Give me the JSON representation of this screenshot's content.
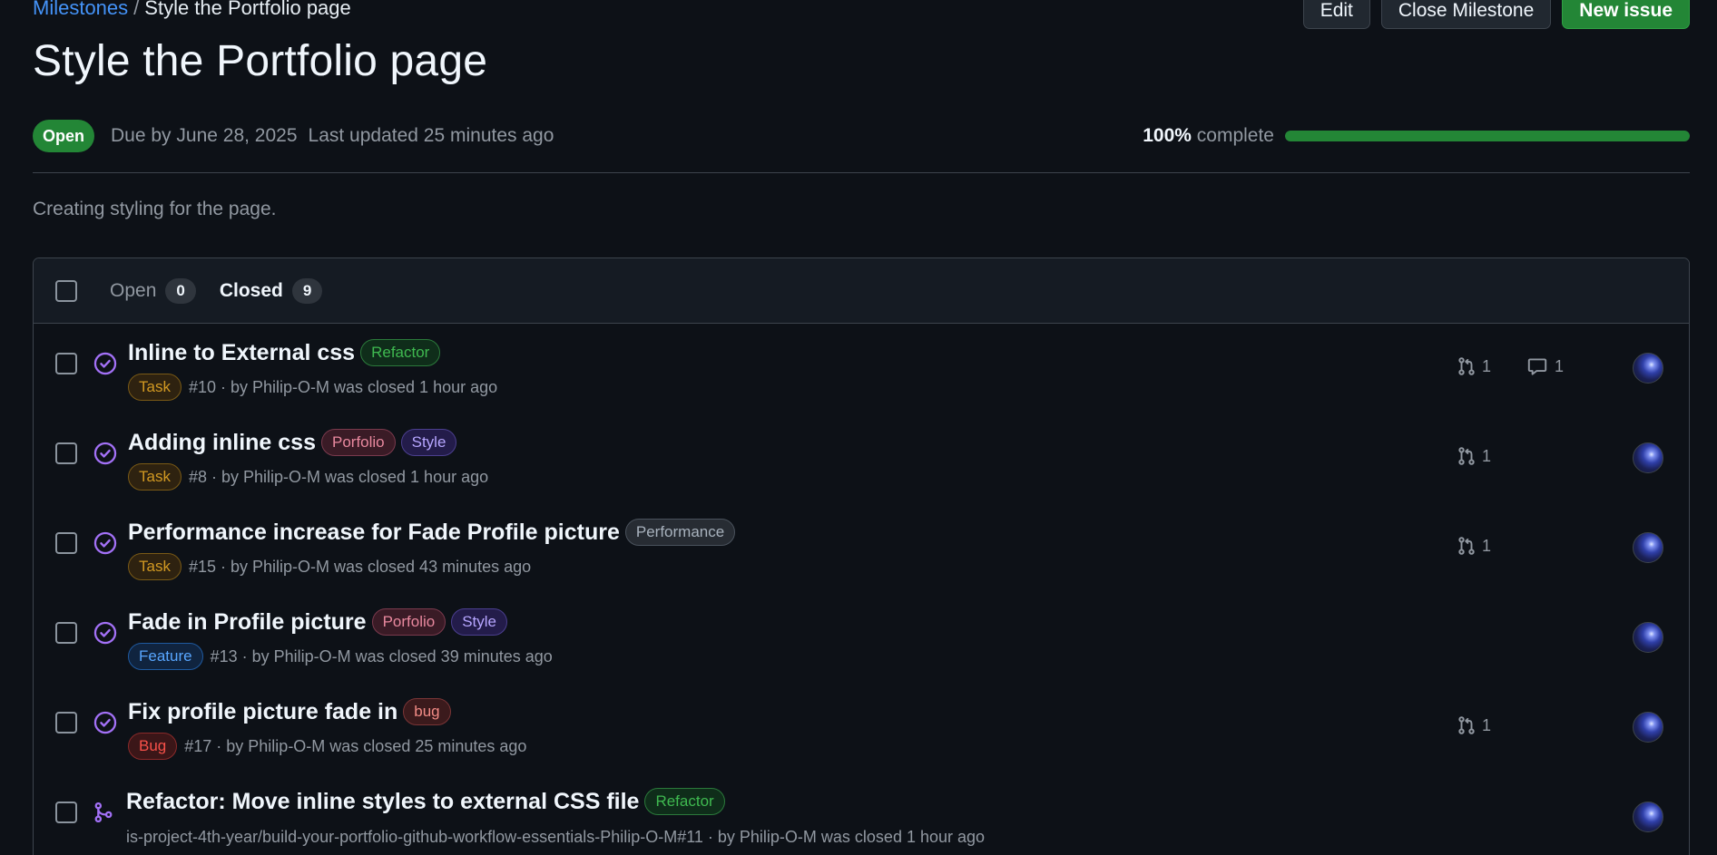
{
  "breadcrumb": {
    "parent": "Milestones",
    "separator": "/",
    "current": "Style the Portfolio page"
  },
  "actions": {
    "edit": "Edit",
    "close": "Close Milestone",
    "new_issue": "New issue"
  },
  "milestone": {
    "title": "Style the Portfolio page",
    "state": "Open",
    "due": "Due by June 28, 2025",
    "updated": "Last updated 25 minutes ago",
    "percent": "100%",
    "percent_suffix": "complete",
    "progress": 1.0,
    "description": "Creating styling for the page."
  },
  "tabs": [
    {
      "label": "Open",
      "count": "0",
      "active": false
    },
    {
      "label": "Closed",
      "count": "9",
      "active": true
    }
  ],
  "colors": {
    "accent_green": "#238636",
    "link_blue": "#4493f8",
    "closed_purple": "#a371f7",
    "background": "#0d1117"
  },
  "labels": {
    "Refactor": {
      "fg": "#3fb950",
      "bg": "#0f2d1a",
      "border": "#2b7a3b"
    },
    "Task": {
      "fg": "#d29922",
      "bg": "#2e2210",
      "border": "#7a5a16"
    },
    "Porfolio": {
      "fg": "#e8889e",
      "bg": "#3a1b26",
      "border": "#7a3a4d"
    },
    "Style": {
      "fg": "#b6a6ff",
      "bg": "#231c4a",
      "border": "#4b3f8f"
    },
    "Performance": {
      "fg": "#a8b2bd",
      "bg": "#272c33",
      "border": "#4a525c"
    },
    "Feature": {
      "fg": "#58a6ff",
      "bg": "#10243f",
      "border": "#1f5aa0"
    },
    "bug": {
      "fg": "#f28b86",
      "bg": "#3b1a1c",
      "border": "#7a3536"
    },
    "Bug": {
      "fg": "#f85149",
      "bg": "#3b1618",
      "border": "#8a2a2a"
    }
  },
  "issues": [
    {
      "title": "Inline to External css",
      "labels": [
        "Refactor"
      ],
      "type_label": "Task",
      "meta": "#10 · by Philip-O-M was closed 1 hour ago",
      "icon": "closed-issue-icon",
      "prs": "1",
      "comments": "1"
    },
    {
      "title": "Adding inline css",
      "labels": [
        "Porfolio",
        "Style"
      ],
      "type_label": "Task",
      "meta": "#8 · by Philip-O-M was closed 1 hour ago",
      "icon": "closed-issue-icon",
      "prs": "1",
      "comments": null
    },
    {
      "title": "Performance increase for Fade Profile picture",
      "labels": [
        "Performance"
      ],
      "type_label": "Task",
      "meta": "#15 · by Philip-O-M was closed 43 minutes ago",
      "icon": "closed-issue-icon",
      "prs": "1",
      "comments": null
    },
    {
      "title": "Fade in Profile picture",
      "labels": [
        "Porfolio",
        "Style"
      ],
      "type_label": "Feature",
      "meta": "#13 · by Philip-O-M was closed 39 minutes ago",
      "icon": "closed-issue-icon",
      "prs": null,
      "comments": null
    },
    {
      "title": "Fix profile picture fade in",
      "labels": [
        "bug"
      ],
      "type_label": "Bug",
      "meta": "#17 · by Philip-O-M was closed 25 minutes ago",
      "icon": "closed-issue-icon",
      "prs": "1",
      "comments": null
    },
    {
      "title": "Refactor: Move inline styles to external CSS file",
      "labels": [
        "Refactor"
      ],
      "type_label": null,
      "meta": "is-project-4th-year/build-your-portfolio-github-workflow-essentials-Philip-O-M#11 · by Philip-O-M was closed 1 hour ago",
      "icon": "merged-pr-icon",
      "prs": null,
      "comments": null
    }
  ]
}
